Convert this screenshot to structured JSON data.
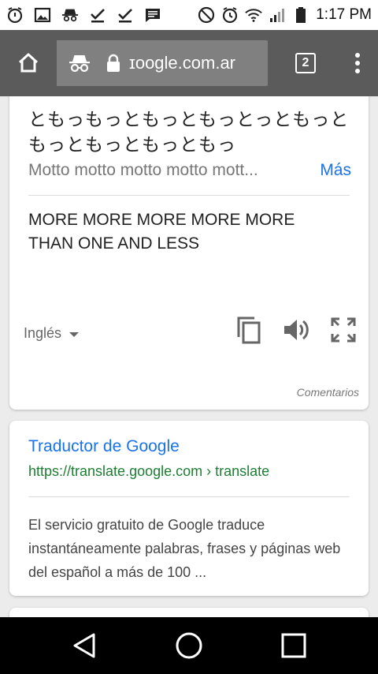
{
  "status_bar": {
    "time": "1:17 PM",
    "notification_icons": [
      "alarm-badge-icon",
      "image-icon",
      "incognito-icon",
      "download-done-icon",
      "download-done-icon",
      "message-icon"
    ],
    "system_icons": [
      "dnd-icon",
      "alarm-icon",
      "wifi-icon",
      "signal-icon",
      "battery-icon"
    ]
  },
  "toolbar": {
    "url": "ɪoogle.com.ar",
    "tab_count": "2"
  },
  "translate_card": {
    "source_text": "ともっもっともっともっとっともっともっともっともっともっ",
    "romaji": "Motto motto motto motto mott...",
    "more_link": "Más",
    "translation": "MORE MORE MORE MORE MORE THAN ONE AND LESS",
    "target_language": "Inglés",
    "feedback": "Comentarios"
  },
  "result_card": {
    "title": "Traductor de Google",
    "url": "https://translate.google.com › translate",
    "snippet": "El servicio gratuito de Google traduce instantáneamente palabras, frases y páginas web del español a más de 100  ..."
  },
  "colors": {
    "toolbar_bg": "#5b5b5b",
    "link_blue": "#1a73e8",
    "url_green": "#1e7d32"
  }
}
